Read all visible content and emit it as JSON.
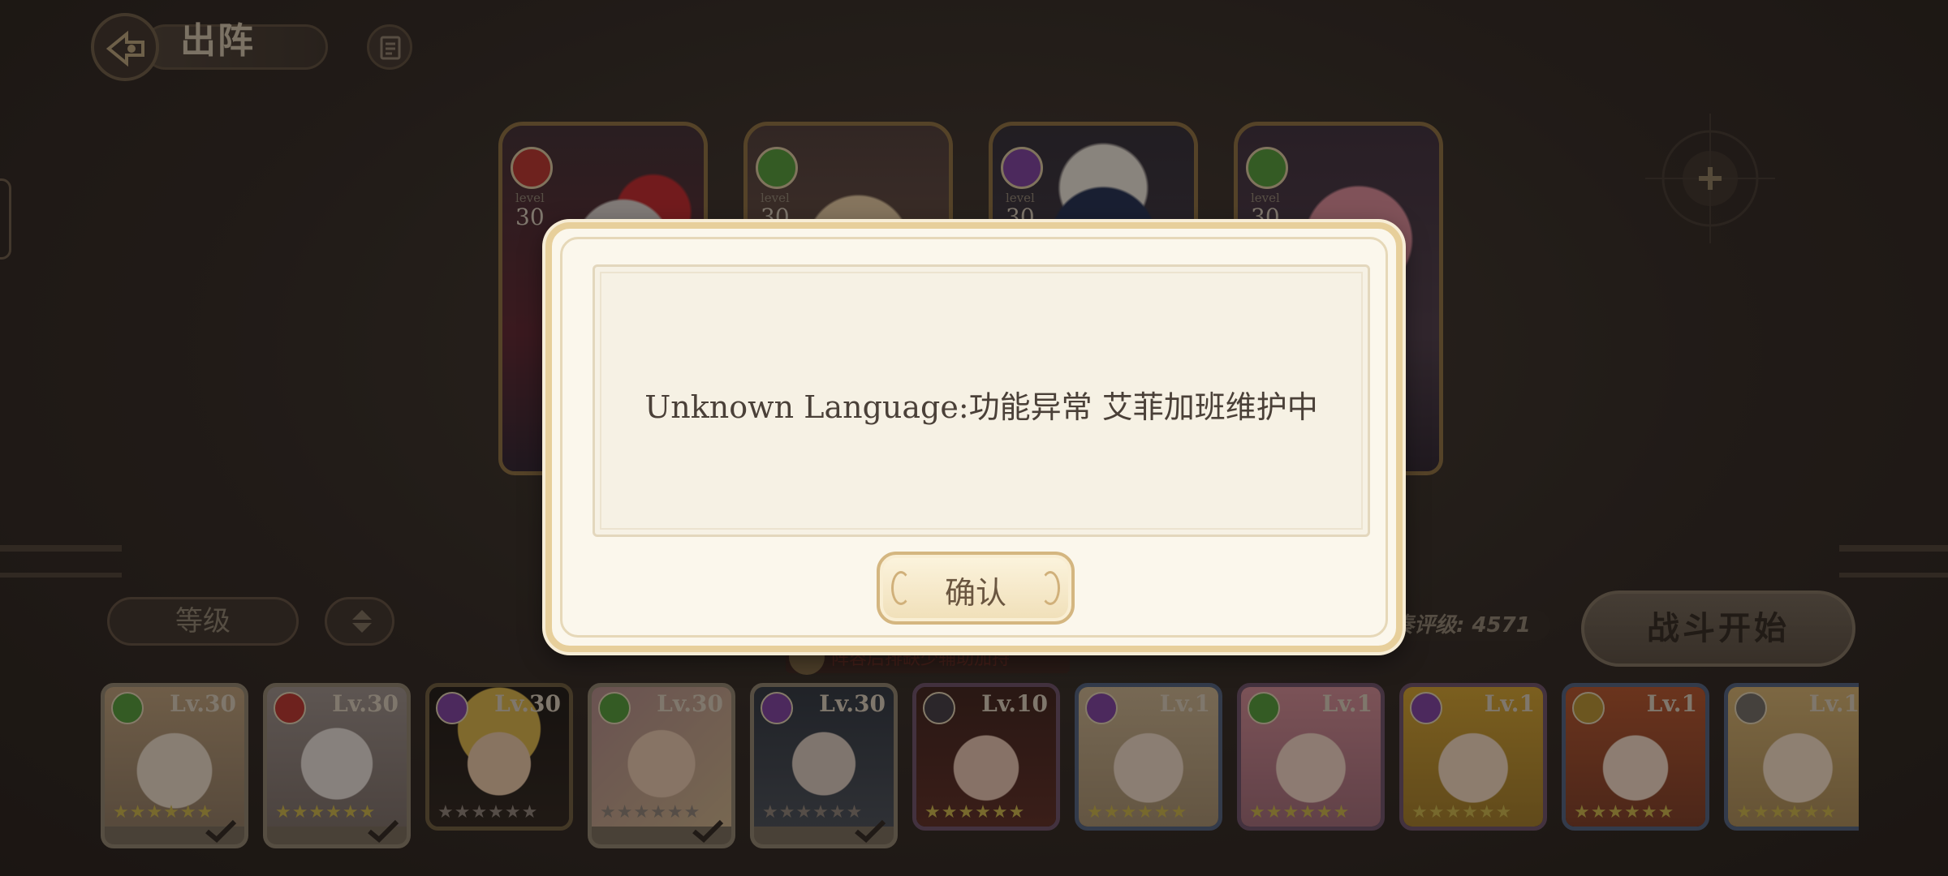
{
  "header": {
    "title": "出阵"
  },
  "team_cards": [
    {
      "level_label": "level",
      "level": "30",
      "class_color": "#b8322e"
    },
    {
      "level_label": "level",
      "level": "30",
      "class_color": "#4f9a3a"
    },
    {
      "level_label": "level",
      "level": "30",
      "class_color": "#7b3fa0"
    },
    {
      "level_label": "level",
      "level": "30",
      "class_color": "#4f9a3a"
    }
  ],
  "controls": {
    "sort_label": "等级",
    "rating_label": "合奏评级: 4571",
    "battle_label": "战斗开始",
    "hint_text": "阵容后排缺少辅助加持"
  },
  "roster": [
    {
      "level": "Lv.30",
      "class_color": "#4f9a3a",
      "stars": "★★★★★★",
      "selected": true
    },
    {
      "level": "Lv.30",
      "class_color": "#b8322e",
      "stars": "★★★★★★",
      "selected": true
    },
    {
      "level": "Lv.30",
      "class_color": "#7b3fa0",
      "stars": "★★★★★★",
      "selected": false
    },
    {
      "level": "Lv.30",
      "class_color": "#4f9a3a",
      "stars": "★★★★★★",
      "selected": true
    },
    {
      "level": "Lv.30",
      "class_color": "#7b3fa0",
      "stars": "★★★★★★",
      "selected": true
    },
    {
      "level": "Lv.10",
      "class_color": "#3f3a44",
      "stars": "★★★★★★",
      "selected": false
    },
    {
      "level": "Lv.1",
      "class_color": "#7b3fa0",
      "stars": "★★★★★★",
      "selected": false
    },
    {
      "level": "Lv.1",
      "class_color": "#4f9a3a",
      "stars": "★★★★★★",
      "selected": false
    },
    {
      "level": "Lv.1",
      "class_color": "#7b3fa0",
      "stars": "★★★★★★",
      "selected": false
    },
    {
      "level": "Lv.1",
      "class_color": "#b59032",
      "stars": "★★★★★★",
      "selected": false
    },
    {
      "level": "Lv.1",
      "class_color": "#6e6a66",
      "stars": "★★★★★★",
      "selected": false
    }
  ],
  "dialog": {
    "message": "Unknown Language:功能异常 艾菲加班维护中",
    "confirm_label": "确认"
  }
}
